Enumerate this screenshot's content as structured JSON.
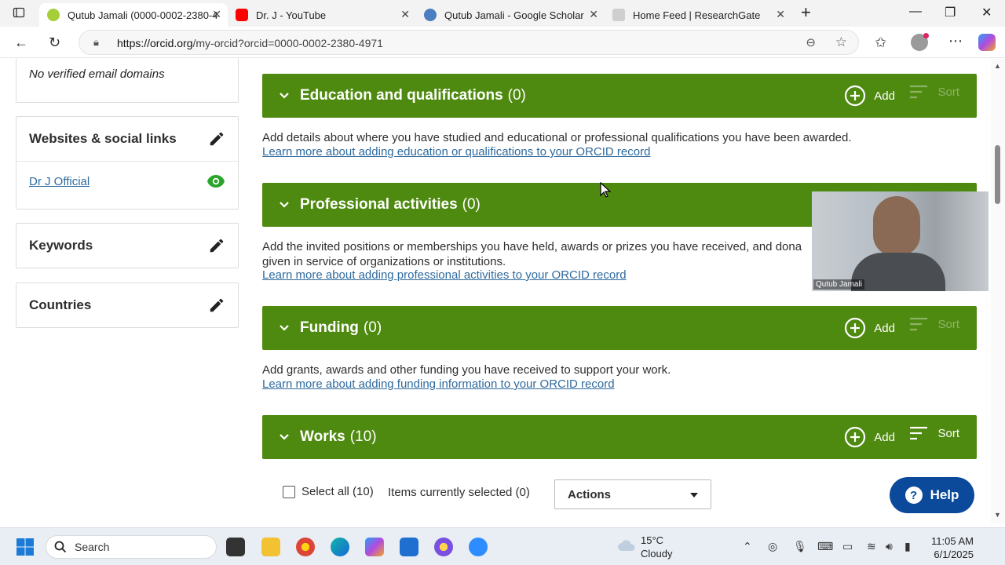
{
  "browser": {
    "tabs": [
      {
        "title": "Qutub Jamali (0000-0002-2380-4",
        "favicon_color": "#a6ce39",
        "active": true
      },
      {
        "title": "Dr. J - YouTube",
        "favicon_color": "#ff0000",
        "active": false
      },
      {
        "title": "Qutub Jamali - Google Scholar",
        "favicon_color": "#4a7ec0",
        "active": false
      },
      {
        "title": "Home Feed | ResearchGate",
        "favicon_color": "#cfcfcf",
        "active": false
      }
    ],
    "url_host": "https://orcid.org",
    "url_path": "/my-orcid?orcid=0000-0002-2380-4971"
  },
  "sidebar": {
    "email_note": "No verified email domains",
    "websites_title": "Websites & social links",
    "website_link": "Dr J Official",
    "keywords_title": "Keywords",
    "countries_title": "Countries"
  },
  "sections": {
    "education": {
      "title": "Education and qualifications",
      "count": "(0)",
      "add": "Add",
      "sort": "Sort",
      "desc": "Add details about where you have studied and educational or professional qualifications you have been awarded.",
      "link": "Learn more about adding education or qualifications to your ORCID record"
    },
    "professional": {
      "title": "Professional activities",
      "count": "(0)",
      "desc1": "Add the invited positions or memberships you have held, awards or prizes you have received, and dona",
      "desc2": "given in service of organizations or institutions.",
      "link": "Learn more about adding professional activities to your ORCID record"
    },
    "funding": {
      "title": "Funding",
      "count": "(0)",
      "add": "Add",
      "sort": "Sort",
      "desc": "Add grants, awards and other funding you have received to support your work.",
      "link": "Learn more about adding funding information to your ORCID record"
    },
    "works": {
      "title": "Works",
      "count": "(10)",
      "add": "Add",
      "sort": "Sort",
      "select_all": "Select all (10)",
      "items_selected": "Items currently selected (0)",
      "actions": "Actions"
    }
  },
  "video_overlay": {
    "name": "Qutub Jamali"
  },
  "help_button": "Help",
  "taskbar": {
    "search": "Search",
    "temp": "15°C",
    "condition": "Cloudy",
    "time": "11:05 AM",
    "date": "6/1/2025"
  },
  "colors": {
    "orcid_green": "#4f8a10",
    "link_blue": "#2e6a9e",
    "help_blue": "#0b4a9a"
  }
}
